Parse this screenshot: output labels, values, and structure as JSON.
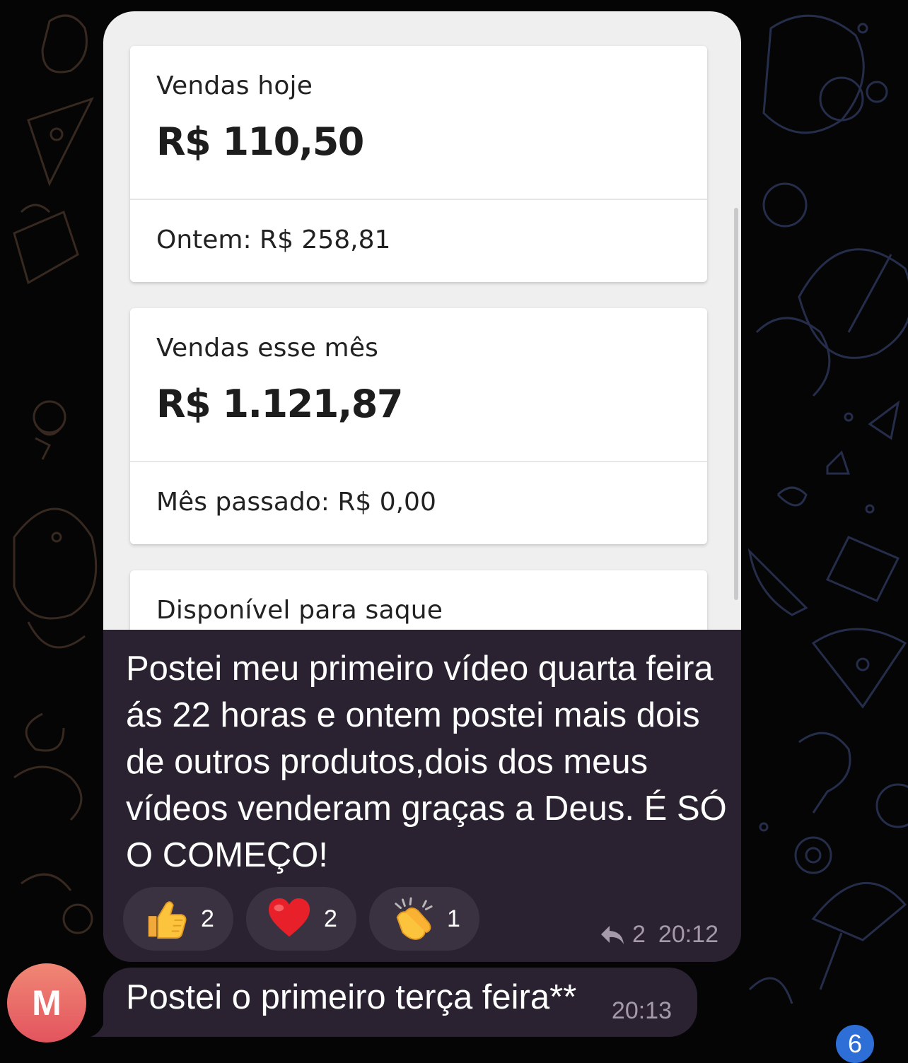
{
  "screenshot_card": {
    "today": {
      "title": "Vendas hoje",
      "amount": "R$ 110,50",
      "comparison": "Ontem: R$ 258,81"
    },
    "month": {
      "title": "Vendas esse mês",
      "amount": "R$ 1.121,87",
      "comparison": "Mês passado: R$ 0,00"
    },
    "available": {
      "title": "Disponível para saque"
    }
  },
  "message": {
    "text": "Postei meu primeiro vídeo quarta feira ás 22 horas e ontem postei mais dois de outros produtos,dois dos meus vídeos venderam graças a Deus. É SÓ O COMEÇO!",
    "reactions": [
      {
        "icon": "thumbs-up-icon",
        "count": "2"
      },
      {
        "icon": "heart-icon",
        "count": "2"
      },
      {
        "icon": "clapping-hands-icon",
        "count": "1"
      }
    ],
    "reply_count": "2",
    "time": "20:12"
  },
  "second_message": {
    "avatar_letter": "M",
    "text": "Postei o primeiro terça feira**",
    "time": "20:13"
  },
  "unread_count": "6",
  "colors": {
    "background": "#050505",
    "bubble": "#2a2231",
    "reaction_pill": "#3a3240",
    "meta_text": "#a59aaa",
    "avatar": "#e96a68",
    "badge": "#2d6fd6"
  }
}
